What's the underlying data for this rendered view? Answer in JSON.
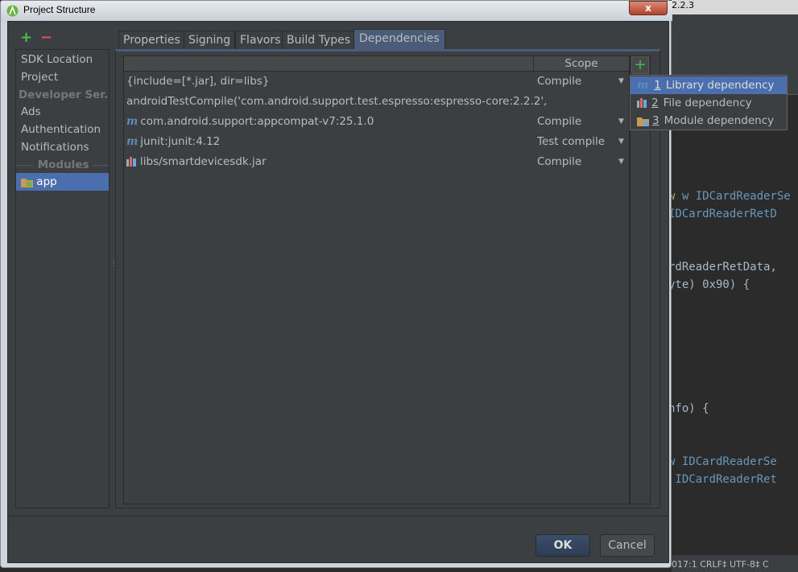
{
  "window": {
    "title": "Project Structure",
    "close": "x"
  },
  "ide": {
    "top_text": "2.2.3",
    "code": [
      "w IDCardReaderSe",
      "IDCardReaderRetD",
      "rdReaderRetData,",
      "yte) 0x90) {",
      "nfo) {",
      "w IDCardReaderSe",
      " IDCardReaderRet"
    ],
    "status": "017:1  CRLF‡  UTF-8‡  C"
  },
  "sidebar": {
    "add": "+",
    "remove": "−",
    "items": [
      {
        "label": "SDK Location",
        "type": "item"
      },
      {
        "label": "Project",
        "type": "item"
      },
      {
        "label": "Developer Ser...",
        "type": "header"
      },
      {
        "label": "Ads",
        "type": "item"
      },
      {
        "label": "Authentication",
        "type": "item"
      },
      {
        "label": "Notifications",
        "type": "item"
      },
      {
        "label": "Modules",
        "type": "header"
      },
      {
        "label": "app",
        "type": "module",
        "selected": true
      }
    ]
  },
  "tabs": [
    {
      "label": "Properties"
    },
    {
      "label": "Signing"
    },
    {
      "label": "Flavors"
    },
    {
      "label": "Build Types"
    },
    {
      "label": "Dependencies",
      "selected": true
    }
  ],
  "table": {
    "headers": [
      "",
      "Scope"
    ],
    "rows": [
      {
        "name": "{include=[*.jar], dir=libs}",
        "scope": "Compile",
        "icon": "none"
      },
      {
        "name": "androidTestCompile('com.android.support.test.espresso:espresso-core:2.2.2',",
        "scope": "",
        "icon": "none"
      },
      {
        "name": "com.android.support:appcompat-v7:25.1.0",
        "scope": "Compile",
        "icon": "maven-icon"
      },
      {
        "name": "junit:junit:4.12",
        "scope": "Test compile",
        "icon": "maven-icon"
      },
      {
        "name": "libs/smartdevicesdk.jar",
        "scope": "Compile",
        "icon": "jar-icon"
      }
    ]
  },
  "add_button": "+",
  "popup": [
    {
      "num": "1",
      "label": "Library dependency",
      "icon": "maven-icon",
      "selected": true
    },
    {
      "num": "2",
      "label": "File dependency",
      "icon": "jar-icon"
    },
    {
      "num": "3",
      "label": "Module dependency",
      "icon": "module-folder-icon"
    }
  ],
  "buttons": {
    "ok": "OK",
    "cancel": "Cancel"
  },
  "colors": {
    "selection": "#4b6eaf",
    "background": "#3c3f41",
    "add_green": "#4cbb4c",
    "remove_red": "#d9534f"
  }
}
